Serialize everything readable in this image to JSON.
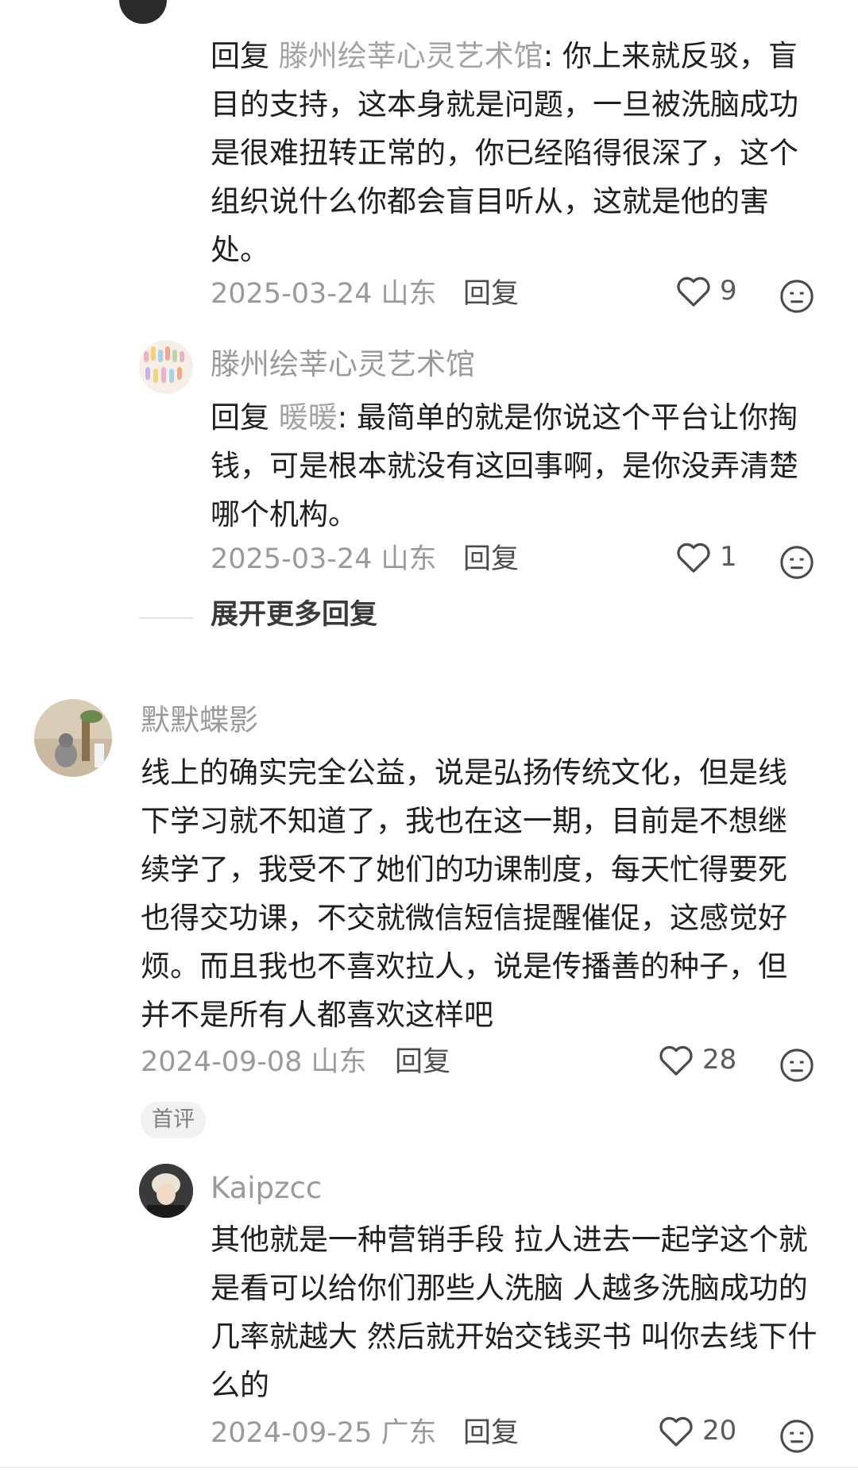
{
  "comments": [
    {
      "reply_prefix": "回复",
      "reply_target": "滕州绘莘心灵艺术馆",
      "text": ": 你上来就反驳，盲目的支持，这本身就是问题，一旦被洗脑成功是很难扭转正常的，你已经陷得很深了，这个组织说什么你都会盲目听从，这就是他的害处。",
      "date": "2025-03-24",
      "location": "山东",
      "reply_label": "回复",
      "likes": "9"
    },
    {
      "username": "滕州绘莘心灵艺术馆",
      "reply_prefix": "回复",
      "reply_target": "暖暖",
      "text": ": 最简单的就是你说这个平台让你掏钱，可是根本就没有这回事啊，是你没弄清楚哪个机构。",
      "date": "2025-03-24",
      "location": "山东",
      "reply_label": "回复",
      "likes": "1"
    },
    {
      "username": "默默蝶影",
      "text": "线上的确实完全公益，说是弘扬传统文化，但是线下学习就不知道了，我也在这一期，目前是不想继续学了，我受不了她们的功课制度，每天忙得要死也得交功课，不交就微信短信提醒催促，这感觉好烦。而且我也不喜欢拉人，说是传播善的种子，但并不是所有人都喜欢这样吧",
      "date": "2024-09-08",
      "location": "山东",
      "reply_label": "回复",
      "likes": "28",
      "badge": "首评"
    },
    {
      "username": "Kaipzcc",
      "text": "其他就是一种营销手段 拉人进去一起学这个就是看可以给你们那些人洗脑 人越多洗脑成功的几率就越大 然后就开始交钱买书 叫你去线下什么的",
      "date": "2024-09-25",
      "location": "广东",
      "reply_label": "回复",
      "likes": "20"
    }
  ],
  "expand_replies_label": "展开更多回复",
  "colors": {
    "text": "#1f1f1f",
    "muted": "#9a9a9a",
    "reply_target": "#a3a3a3",
    "badge_bg": "#f1f1f1"
  },
  "icons": [
    "heart-icon",
    "dislike-face-icon"
  ]
}
